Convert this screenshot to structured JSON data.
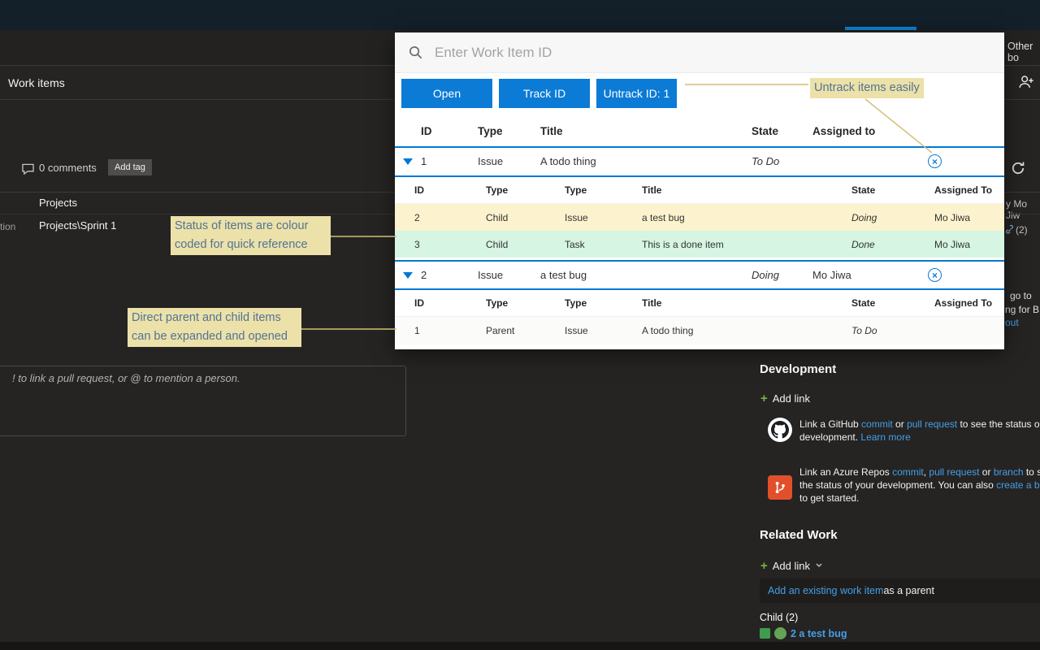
{
  "colors": {
    "accent": "#0078d4",
    "doing_row": "#fcf3ce",
    "done_row": "#d6f5e3",
    "annotation_bg": "#ece1a8"
  },
  "background": {
    "other_boards": "Other bo",
    "work_items": "Work items",
    "comments": "0 comments",
    "add_tag": "Add tag",
    "area_value": "Projects",
    "iteration_label_cut": "tion",
    "iteration_value": "Projects\\Sprint 1",
    "assigned_cut": "y Mo Jiw",
    "link_count": "(2)",
    "cut_text_1": "go to",
    "cut_text_2": "ng for B",
    "cut_text_3": "out",
    "discussion_placeholder": "! to link a pull request, or @ to mention a person.",
    "development": {
      "title": "Development",
      "add_link": "Add link",
      "github": {
        "t1": "Link a GitHub ",
        "l1": "commit",
        "t2": " or ",
        "l2": "pull request",
        "t3": " to see the status o",
        "t4": "development. ",
        "l3": "Learn more"
      },
      "azure": {
        "t1": "Link an Azure Repos ",
        "l1": "commit",
        "t2": ", ",
        "l2": "pull request",
        "t3": " or ",
        "l3": "branch",
        "t4": " to s",
        "t5": "the status of your development. You can also ",
        "l4": "create a b",
        "t6": "to get started."
      }
    },
    "related_work": {
      "title": "Related Work",
      "add_link": "Add link",
      "add_existing_link": "Add an existing work item",
      "add_existing_suffix": " as a parent",
      "child_group": "Child (2)",
      "child_item": "2 a test bug"
    }
  },
  "popup": {
    "search_placeholder": "Enter Work Item ID",
    "buttons": {
      "open": "Open",
      "track": "Track ID",
      "untrack": "Untrack ID: 1"
    },
    "headers": {
      "id": "ID",
      "type": "Type",
      "title": "Title",
      "state": "State",
      "assigned": "Assigned to"
    },
    "sub_headers": {
      "id": "ID",
      "rel": "Type",
      "type": "Type",
      "title": "Title",
      "state": "State",
      "assigned": "Assigned To"
    },
    "items": [
      {
        "id": "1",
        "type": "Issue",
        "title": "A todo thing",
        "state": "To Do",
        "assigned": "",
        "children": [
          {
            "id": "2",
            "rel": "Child",
            "type": "Issue",
            "title": "a test bug",
            "state": "Doing",
            "assigned": "Mo Jiwa"
          },
          {
            "id": "3",
            "rel": "Child",
            "type": "Task",
            "title": "This is a done item",
            "state": "Done",
            "assigned": "Mo Jiwa"
          }
        ]
      },
      {
        "id": "2",
        "type": "Issue",
        "title": "a test bug",
        "state": "Doing",
        "assigned": "Mo Jiwa",
        "children": [
          {
            "id": "1",
            "rel": "Parent",
            "type": "Issue",
            "title": "A todo thing",
            "state": "To Do",
            "assigned": ""
          }
        ]
      }
    ]
  },
  "annotations": {
    "untrack": "Untrack items easily",
    "status": "Status of items are colour coded for quick reference",
    "expand": "Direct parent and child items can be expanded and opened"
  }
}
